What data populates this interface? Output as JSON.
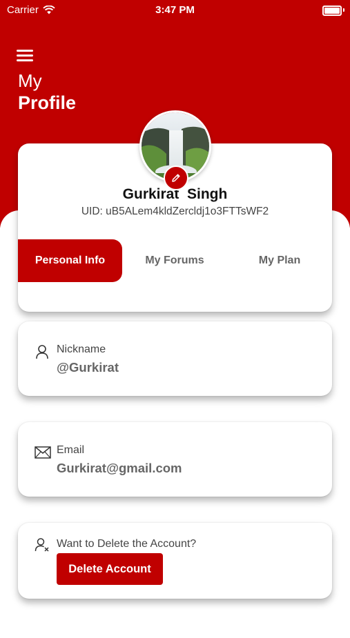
{
  "status_bar": {
    "carrier": "Carrier",
    "time": "3:47 PM"
  },
  "header": {
    "title_line1": "My",
    "title_line2": "Profile"
  },
  "profile": {
    "name": "Gurkirat  Singh",
    "uid": "UID: uB5ALem4kldZercldj1o3FTTsWF2"
  },
  "tabs": [
    {
      "label": "Personal Info",
      "active": true
    },
    {
      "label": "My Forums",
      "active": false
    },
    {
      "label": "My Plan",
      "active": false
    }
  ],
  "fields": {
    "nickname": {
      "label": "Nickname",
      "value": "@Gurkirat"
    },
    "email": {
      "label": "Email",
      "value": "Gurkirat@gmail.com"
    }
  },
  "delete_section": {
    "prompt": "Want to Delete the Account?",
    "button_label": "Delete Account"
  },
  "colors": {
    "brand_red": "#c00000",
    "background": "#ffffff"
  },
  "icons": [
    "wifi-icon",
    "battery-icon",
    "menu-icon",
    "pencil-icon",
    "user-icon",
    "mail-icon",
    "user-remove-icon"
  ]
}
